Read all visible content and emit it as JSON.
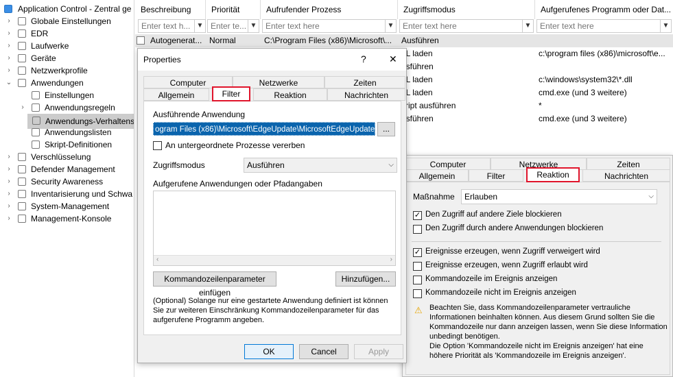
{
  "tree": {
    "root": "Application Control - Zentral ge",
    "items": [
      {
        "label": "Globale Einstellungen",
        "icon": "globe-gear-icon",
        "expand": "closed"
      },
      {
        "label": "EDR",
        "icon": "tools-icon",
        "expand": "closed"
      },
      {
        "label": "Laufwerke",
        "icon": "drive-icon",
        "expand": "closed"
      },
      {
        "label": "Geräte",
        "icon": "device-icon",
        "expand": "closed"
      },
      {
        "label": "Netzwerkprofile",
        "icon": "network-icon",
        "expand": "closed"
      },
      {
        "label": "Anwendungen",
        "icon": "application-icon",
        "expand": "open"
      },
      {
        "label": "Einstellungen",
        "icon": "gear-icon",
        "expand": "none"
      },
      {
        "label": "Anwendungsregeln",
        "icon": "gear-icon",
        "expand": "closed"
      },
      {
        "label": "Anwendungs-Verhaltens",
        "icon": "shield-doc-icon",
        "expand": "none"
      },
      {
        "label": "Anwendungslisten",
        "icon": "list-icon",
        "expand": "none"
      },
      {
        "label": "Skript-Definitionen",
        "icon": "script-icon",
        "expand": "none"
      },
      {
        "label": "Verschlüsselung",
        "icon": "lock-icon",
        "expand": "closed"
      },
      {
        "label": "Defender Management",
        "icon": "shield-icon",
        "expand": "closed"
      },
      {
        "label": "Security Awareness",
        "icon": "person-icon",
        "expand": "closed"
      },
      {
        "label": "Inventarisierung und Schwa",
        "icon": "inventory-icon",
        "expand": "closed"
      },
      {
        "label": "System-Management",
        "icon": "system-icon",
        "expand": "closed"
      },
      {
        "label": "Management-Konsole",
        "icon": "console-icon",
        "expand": "closed"
      }
    ]
  },
  "grid": {
    "columns": [
      "Beschreibung",
      "Priorität",
      "Aufrufender Prozess",
      "Zugriffsmodus",
      "Aufgerufenes Programm oder Dat..."
    ],
    "filter_placeholders": [
      "Enter text h...",
      "Enter te...",
      "Enter text here",
      "Enter text here",
      "Enter text here"
    ],
    "rows": [
      [
        "Autogenerat...",
        "Normal",
        "C:\\Program Files (x86)\\Microsoft\\...",
        "Ausführen",
        ""
      ],
      [
        "",
        "",
        "",
        "LL laden",
        "c:\\program files (x86)\\microsoft\\e..."
      ],
      [
        "",
        "",
        "",
        "usführen",
        ""
      ],
      [
        "",
        "",
        "",
        "LL laden",
        "c:\\windows\\system32\\*.dll"
      ],
      [
        "",
        "",
        "",
        "LL laden",
        "cmd.exe (und 3 weitere)"
      ],
      [
        "",
        "",
        "",
        "kript ausführen",
        "*"
      ],
      [
        "",
        "",
        "",
        "usführen",
        "cmd.exe (und 3 weitere)"
      ]
    ]
  },
  "dlg1": {
    "title": "Properties",
    "help": "?",
    "close": "✕",
    "tabs_top": [
      "Computer",
      "Netzwerke",
      "Zeiten"
    ],
    "tabs_bottom": [
      "Allgemein",
      "Filter",
      "Reaktion",
      "Nachrichten"
    ],
    "app_label": "Ausführende Anwendung",
    "app_value": "ogram Files (x86)\\Microsoft\\EdgeUpdate\\MicrosoftEdgeUpdate.exe",
    "browse": "...",
    "inherit": "An untergeordnete Prozesse vererben",
    "mode_label": "Zugriffsmodus",
    "mode_value": "Ausführen",
    "called_label": "Aufgerufene Anwendungen oder Pfadangaben",
    "cmd_btn": "Kommandozeilenparameter einfügen",
    "add_btn": "Hinzufügen...",
    "note": "(Optional) Solange nur eine gestartete Anwendung definiert ist können Sie zur weiteren Einschränkung Kommandozeilenparameter für das aufgerufene Programm angeben.",
    "ok": "OK",
    "cancel": "Cancel",
    "apply": "Apply"
  },
  "dlg2": {
    "tabs_top": [
      "Computer",
      "Netzwerke",
      "Zeiten"
    ],
    "tabs_bottom": [
      "Allgemein",
      "Filter",
      "Reaktion",
      "Nachrichten"
    ],
    "measure_label": "Maßnahme",
    "measure_value": "Erlauben",
    "checks": [
      {
        "label": "Den Zugriff auf andere Ziele blockieren",
        "checked": "✓"
      },
      {
        "label": "Den Zugriff durch andere Anwendungen blockieren",
        "checked": ""
      },
      {
        "label": "Ereignisse erzeugen, wenn Zugriff verweigert wird",
        "checked": "✓"
      },
      {
        "label": "Ereignisse erzeugen, wenn Zugriff erlaubt wird",
        "checked": ""
      },
      {
        "label": "Kommandozeile im Ereignis anzeigen",
        "checked": ""
      },
      {
        "label": "Kommandozeile nicht im Ereignis anzeigen",
        "checked": ""
      }
    ],
    "warn1": "Beachten Sie, dass Kommandozeilenparameter vertrauliche",
    "warn2": "Informationen beinhalten können. Aus diesem Grund sollten Sie die",
    "warn3": "Kommandozeile nur dann anzeigen lassen, wenn Sie diese Information",
    "warn4": "unbedingt benötigen.",
    "warn5": "Die Option 'Kommandozeile nicht im Ereignis anzeigen' hat eine",
    "warn6": "höhere Priorität als 'Kommandozeile im Ereignis anzeigen'."
  }
}
